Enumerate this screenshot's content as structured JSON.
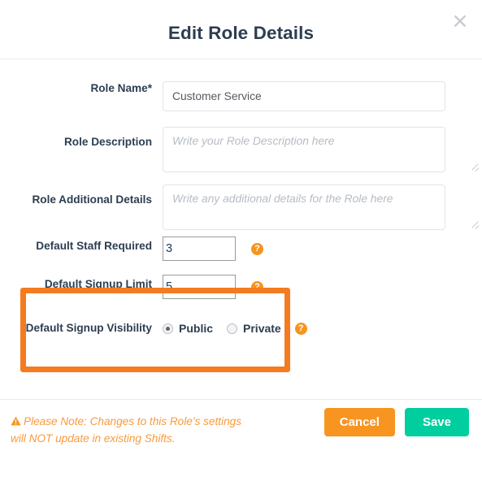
{
  "modal": {
    "title": "Edit Role Details",
    "close_icon": "close-icon"
  },
  "form": {
    "role_name": {
      "label": "Role Name*",
      "value": "Customer Service",
      "placeholder": ""
    },
    "role_description": {
      "label": "Role Description",
      "value": "",
      "placeholder": "Write your Role Description here"
    },
    "role_additional_details": {
      "label": "Role Additional Details",
      "value": "",
      "placeholder": "Write any additional details for the Role here"
    },
    "default_staff_required": {
      "label": "Default Staff Required",
      "value": "3",
      "help_icon": "help-icon"
    },
    "default_signup_limit": {
      "label": "Default Signup Limit",
      "value": "5",
      "help_icon": "help-icon"
    },
    "default_signup_visibility": {
      "label": "Default Signup Visibility",
      "options": [
        {
          "label": "Public",
          "selected": true
        },
        {
          "label": "Private",
          "selected": false
        }
      ],
      "help_icon": "help-icon"
    }
  },
  "footer": {
    "note": "Please Note: Changes to this Role’s settings will NOT update in existing Shifts.",
    "warning_icon": "warning-triangle-icon",
    "cancel_label": "Cancel",
    "save_label": "Save"
  },
  "colors": {
    "highlight": "#f47b20",
    "help": "#f7941d",
    "cancel": "#f79520",
    "save": "#00ce9f",
    "note_text": "#f89a3c",
    "label_text": "#2c3e50"
  }
}
